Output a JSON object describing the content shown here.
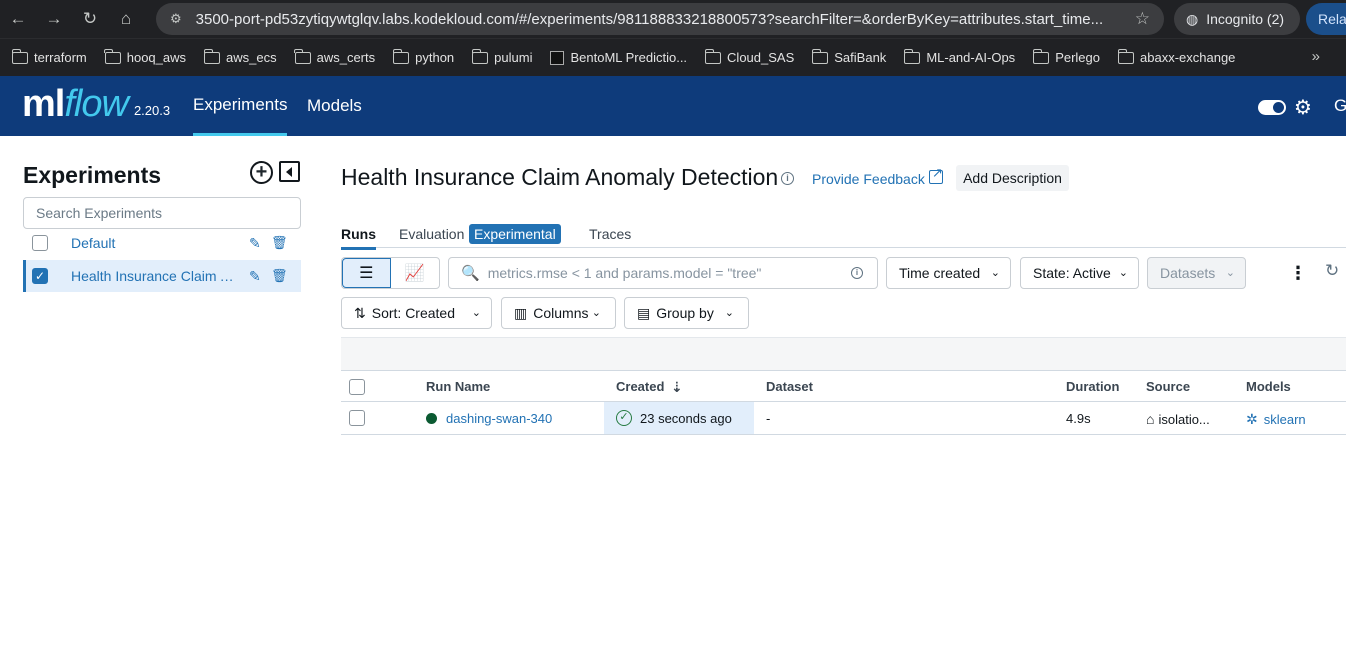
{
  "browser": {
    "url": "3500-port-pd53zytiqywtglqv.labs.kodekloud.com/#/experiments/981188833218800573?searchFilter=&orderByKey=attributes.start_time...",
    "incognito_label": "Incognito (2)",
    "relaunch_label": "Relau",
    "bookmarks": [
      "terraform",
      "hooq_aws",
      "aws_ecs",
      "aws_certs",
      "python",
      "pulumi",
      "BentoML Predictio...",
      "Cloud_SAS",
      "SafiBank",
      "ML-and-AI-Ops",
      "Perlego",
      "abaxx-exchange"
    ]
  },
  "header": {
    "logo_ml": "ml",
    "logo_flow": "flow",
    "version": "2.20.3",
    "tabs": [
      {
        "label": "Experiments",
        "active": true
      },
      {
        "label": "Models",
        "active": false
      }
    ],
    "user_initial": "G"
  },
  "sidebar": {
    "title": "Experiments",
    "search_placeholder": "Search Experiments",
    "experiments": [
      {
        "name": "Default",
        "checked": false
      },
      {
        "name": "Health Insurance Claim Anomaly Detection",
        "checked": true
      }
    ]
  },
  "main": {
    "title": "Health Insurance Claim Anomaly Detection",
    "feedback_label": "Provide Feedback",
    "add_description_label": "Add Description",
    "tabs": {
      "runs": "Runs",
      "evaluation": "Evaluation",
      "experimental_badge": "Experimental",
      "traces": "Traces"
    },
    "toolbar": {
      "search_placeholder": "metrics.rmse < 1 and params.model = \"tree\"",
      "time_created": "Time created",
      "state": "State: Active",
      "datasets": "Datasets",
      "sort": "Sort: Created",
      "columns": "Columns",
      "group_by": "Group by"
    },
    "table": {
      "headers": {
        "run_name": "Run Name",
        "created": "Created",
        "dataset": "Dataset",
        "duration": "Duration",
        "source": "Source",
        "models": "Models"
      },
      "rows": [
        {
          "run_name": "dashing-swan-340",
          "created": "23 seconds ago",
          "dataset": "-",
          "duration": "4.9s",
          "source": "isolatio...",
          "model": "sklearn"
        }
      ]
    }
  },
  "colors": {
    "header_bg": "#0e3b7b",
    "accent": "#2272b4",
    "logo_flow": "#43c9ed",
    "status_dot": "#0b5a32"
  }
}
